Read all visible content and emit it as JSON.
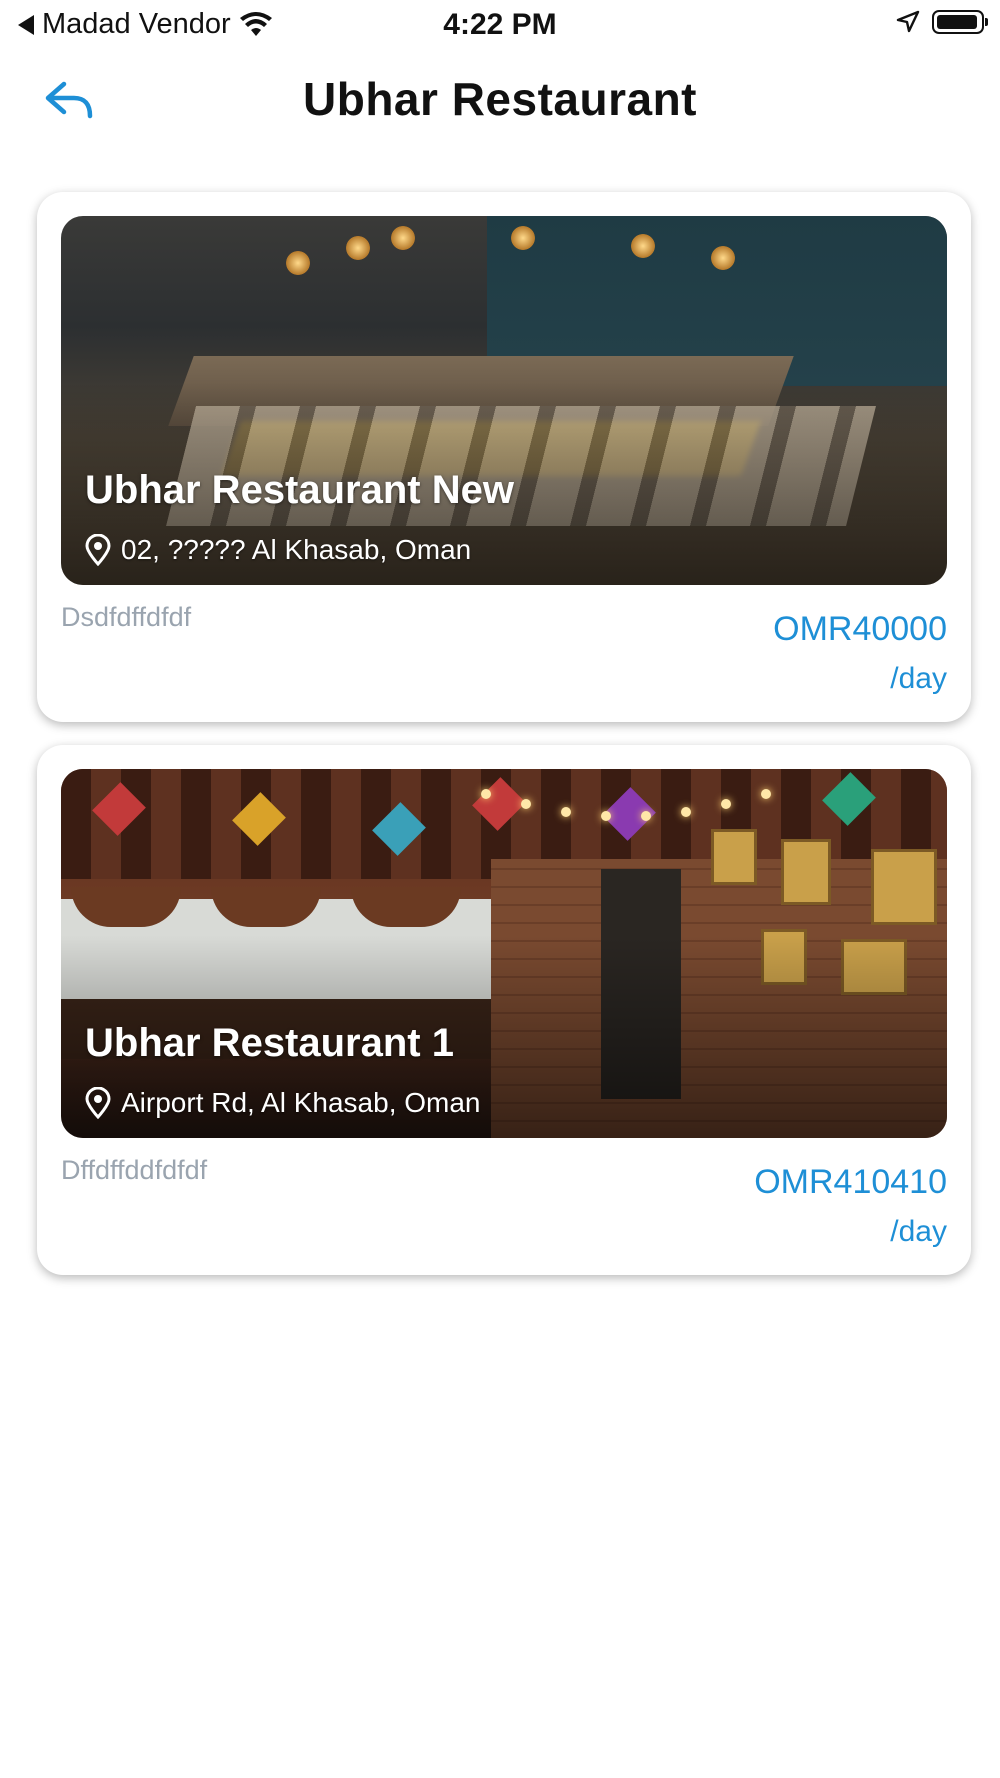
{
  "status_bar": {
    "carrier": "Madad Vendor",
    "time": "4:22 PM"
  },
  "header": {
    "title": "Ubhar Restaurant",
    "back_icon": "reply-arrow-icon"
  },
  "colors": {
    "accent": "#1e8fd6",
    "muted_text": "#9aa4af"
  },
  "listings": [
    {
      "name": "Ubhar Restaurant New",
      "location": "02, ????? Al Khasab, Oman",
      "description": "Dsdfdffdfdf",
      "price": "OMR40000",
      "unit": "/day"
    },
    {
      "name": "Ubhar Restaurant 1",
      "location": "Airport Rd, Al Khasab, Oman",
      "description": "Dffdffddfdfdf",
      "price": "OMR410410",
      "unit": "/day"
    }
  ]
}
